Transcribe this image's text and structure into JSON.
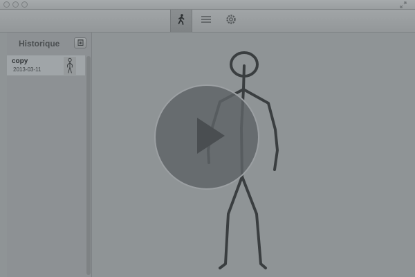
{
  "window": {
    "title": "",
    "fullscreen_icon": "fullscreen-arrows-icon"
  },
  "toolbar": {
    "buttons": [
      {
        "icon": "walking-figure-icon",
        "active": true
      },
      {
        "icon": "list-lines-icon",
        "active": false
      },
      {
        "icon": "gear-icon",
        "active": false
      }
    ]
  },
  "sidebar": {
    "title": "Historique",
    "trash_icon": "trash-icon",
    "items": [
      {
        "name": "copy",
        "date": "2013-03-11",
        "thumb_icon": "stick-figure-icon"
      }
    ]
  },
  "player": {
    "play_icon": "play-icon"
  },
  "colors": {
    "background": "#8f9496",
    "figure_stroke": "#3a3e40",
    "play_overlay": "#5e6367"
  }
}
